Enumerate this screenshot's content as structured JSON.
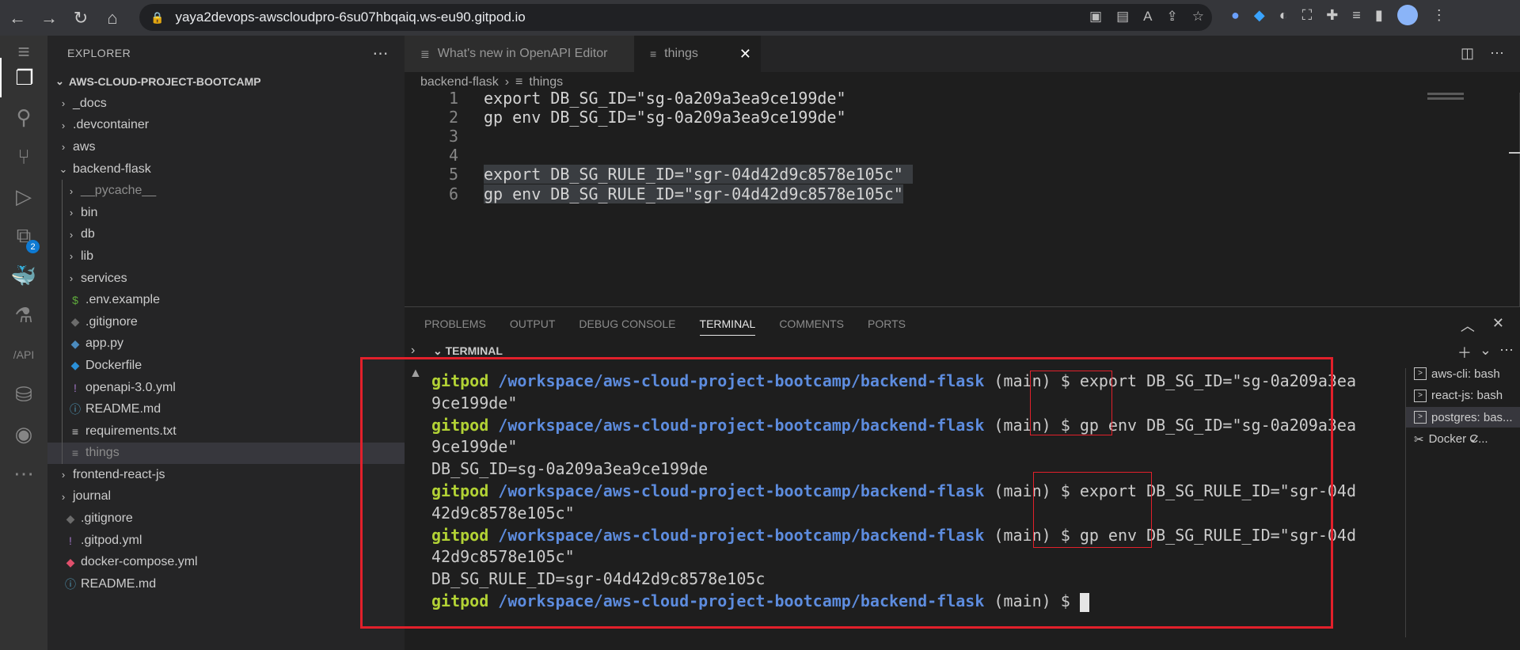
{
  "browser": {
    "url": "yaya2devops-awscloudpro-6su07hbqaiq.ws-eu90.gitpod.io"
  },
  "explorer": {
    "title": "EXPLORER",
    "root": "AWS-CLOUD-PROJECT-BOOTCAMP",
    "items": [
      {
        "label": "_docs",
        "type": "folder"
      },
      {
        "label": ".devcontainer",
        "type": "folder"
      },
      {
        "label": "aws",
        "type": "folder"
      },
      {
        "label": "backend-flask",
        "type": "folder-open"
      },
      {
        "label": "__pycache__",
        "type": "folder"
      },
      {
        "label": "bin",
        "type": "folder"
      },
      {
        "label": "db",
        "type": "folder"
      },
      {
        "label": "lib",
        "type": "folder"
      },
      {
        "label": "services",
        "type": "folder"
      },
      {
        "label": ".env.example",
        "type": "file"
      },
      {
        "label": ".gitignore",
        "type": "file"
      },
      {
        "label": "app.py",
        "type": "file"
      },
      {
        "label": "Dockerfile",
        "type": "file"
      },
      {
        "label": "openapi-3.0.yml",
        "type": "file"
      },
      {
        "label": "README.md",
        "type": "file"
      },
      {
        "label": "requirements.txt",
        "type": "file"
      },
      {
        "label": "things",
        "type": "file"
      },
      {
        "label": "frontend-react-js",
        "type": "folder"
      },
      {
        "label": "journal",
        "type": "folder"
      },
      {
        "label": ".gitignore",
        "type": "file"
      },
      {
        "label": ".gitpod.yml",
        "type": "file"
      },
      {
        "label": "docker-compose.yml",
        "type": "file"
      },
      {
        "label": "README.md",
        "type": "file"
      }
    ]
  },
  "activity": {
    "extensions_badge": "2"
  },
  "tabs": [
    {
      "label": "What's new in OpenAPI Editor"
    },
    {
      "label": "things"
    }
  ],
  "breadcrumb": {
    "folder": "backend-flask",
    "file": "things"
  },
  "editor": {
    "lines": [
      {
        "n": "1",
        "text": "export DB_SG_ID=\"sg-0a209a3ea9ce199de\""
      },
      {
        "n": "2",
        "text": "gp env DB_SG_ID=\"sg-0a209a3ea9ce199de\""
      },
      {
        "n": "3",
        "text": ""
      },
      {
        "n": "4",
        "text": ""
      },
      {
        "n": "5",
        "text": "export DB_SG_RULE_ID=\"sgr-04d42d9c8578e105c\" "
      },
      {
        "n": "6",
        "text": "gp env DB_SG_RULE_ID=\"sgr-04d42d9c8578e105c\""
      }
    ]
  },
  "panel": {
    "tabs": [
      "PROBLEMS",
      "OUTPUT",
      "DEBUG CONSOLE",
      "TERMINAL",
      "COMMENTS",
      "PORTS"
    ],
    "section_title": "TERMINAL"
  },
  "terminal": {
    "user": "gitpod",
    "path": "/workspace/aws-cloud-project-bootcamp/backend-flask",
    "branch": " (main) $ ",
    "lines": [
      {
        "kind": "prompt",
        "cmd": "export DB_SG_ID=\"sg-0a209a3ea"
      },
      {
        "kind": "out",
        "text": "9ce199de\""
      },
      {
        "kind": "prompt",
        "cmd": "gp env DB_SG_ID=\"sg-0a209a3ea"
      },
      {
        "kind": "out",
        "text": "9ce199de\""
      },
      {
        "kind": "out",
        "text": "DB_SG_ID=sg-0a209a3ea9ce199de"
      },
      {
        "kind": "prompt",
        "cmd": "export DB_SG_RULE_ID=\"sgr-04d"
      },
      {
        "kind": "out",
        "text": "42d9c8578e105c\""
      },
      {
        "kind": "prompt",
        "cmd": "gp env DB_SG_RULE_ID=\"sgr-04d"
      },
      {
        "kind": "out",
        "text": "42d9c8578e105c\""
      },
      {
        "kind": "out",
        "text": "DB_SG_RULE_ID=sgr-04d42d9c8578e105c"
      },
      {
        "kind": "prompt",
        "cmd": ""
      }
    ],
    "sessions": [
      {
        "label": "aws-cli: bash"
      },
      {
        "label": "react-js: bash"
      },
      {
        "label": "postgres: bas..."
      },
      {
        "label": "Docker C..."
      }
    ]
  },
  "colors": {
    "highlight_box": "#e2202b",
    "prompt_user": "#b2d235",
    "prompt_path": "#5d8cde"
  }
}
